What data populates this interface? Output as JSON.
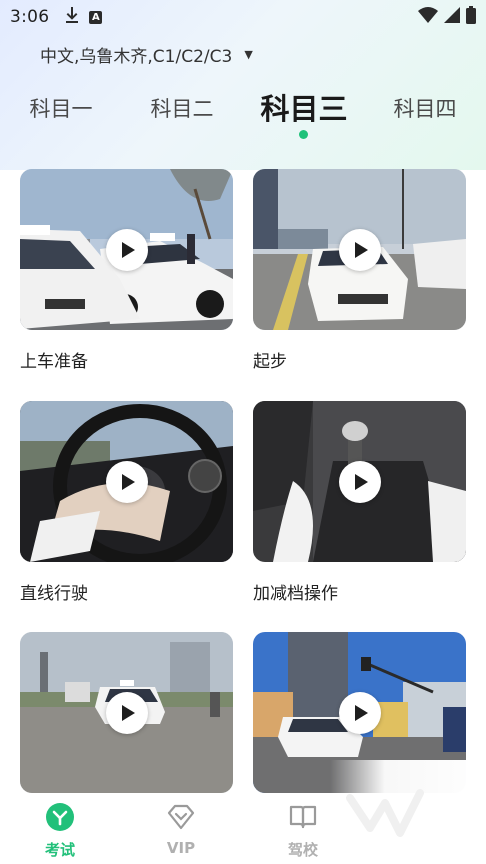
{
  "status_bar": {
    "time": "3:06",
    "download_icon": "download-arrow-icon",
    "a_icon_text": "A",
    "wifi_icon": "wifi-icon",
    "signal_icon": "signal-icon",
    "battery_icon": "battery-icon"
  },
  "region": {
    "label": "中文,乌鲁木齐,C1/C2/C3",
    "caret": "▼"
  },
  "tabs": [
    {
      "label": "科目一",
      "active": false
    },
    {
      "label": "科目二",
      "active": false
    },
    {
      "label": "科目三",
      "active": true
    },
    {
      "label": "科目四",
      "active": false
    }
  ],
  "videos": [
    {
      "title": "上车准备"
    },
    {
      "title": "起步"
    },
    {
      "title": "直线行驶"
    },
    {
      "title": "加减档操作"
    },
    {
      "title": ""
    },
    {
      "title": ""
    }
  ],
  "bottom_nav": [
    {
      "label": "考试",
      "icon": "exam-icon",
      "active": true
    },
    {
      "label": "VIP",
      "icon": "vip-diamond-icon",
      "active": false
    },
    {
      "label": "驾校",
      "icon": "book-icon",
      "active": false
    }
  ],
  "colors": {
    "accent": "#22c07a",
    "inactive": "#b0b0b0"
  }
}
